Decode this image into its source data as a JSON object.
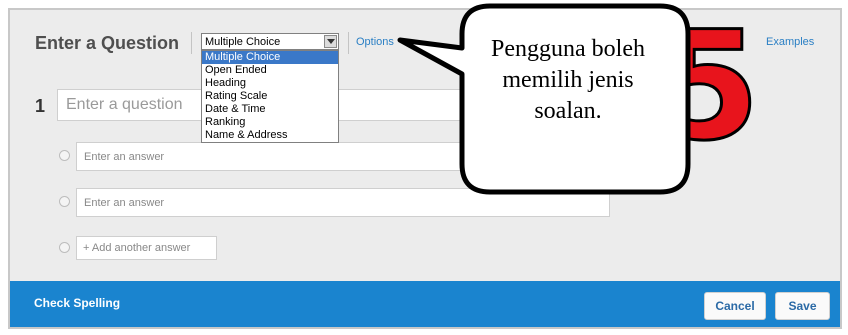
{
  "editor": {
    "title": "Enter a Question",
    "question_type": "Multiple Choice",
    "options_link": "Options",
    "examples_link": "Examples",
    "dropdown_options": [
      "Multiple Choice",
      "Open Ended",
      "Heading",
      "Rating Scale",
      "Date & Time",
      "Ranking",
      "Name & Address"
    ],
    "question_number": "1",
    "question_placeholder": "Enter a question",
    "answer_placeholders": [
      "Enter an answer",
      "Enter an answer"
    ],
    "add_answer_label": "+ Add another answer"
  },
  "footer": {
    "check_spelling": "Check Spelling",
    "cancel_label": "Cancel",
    "save_label": "Save"
  },
  "annotation": {
    "callout_text": "Pengguna boleh memilih jenis soalan.",
    "step_number": "5",
    "step_color": "#e8141c"
  }
}
